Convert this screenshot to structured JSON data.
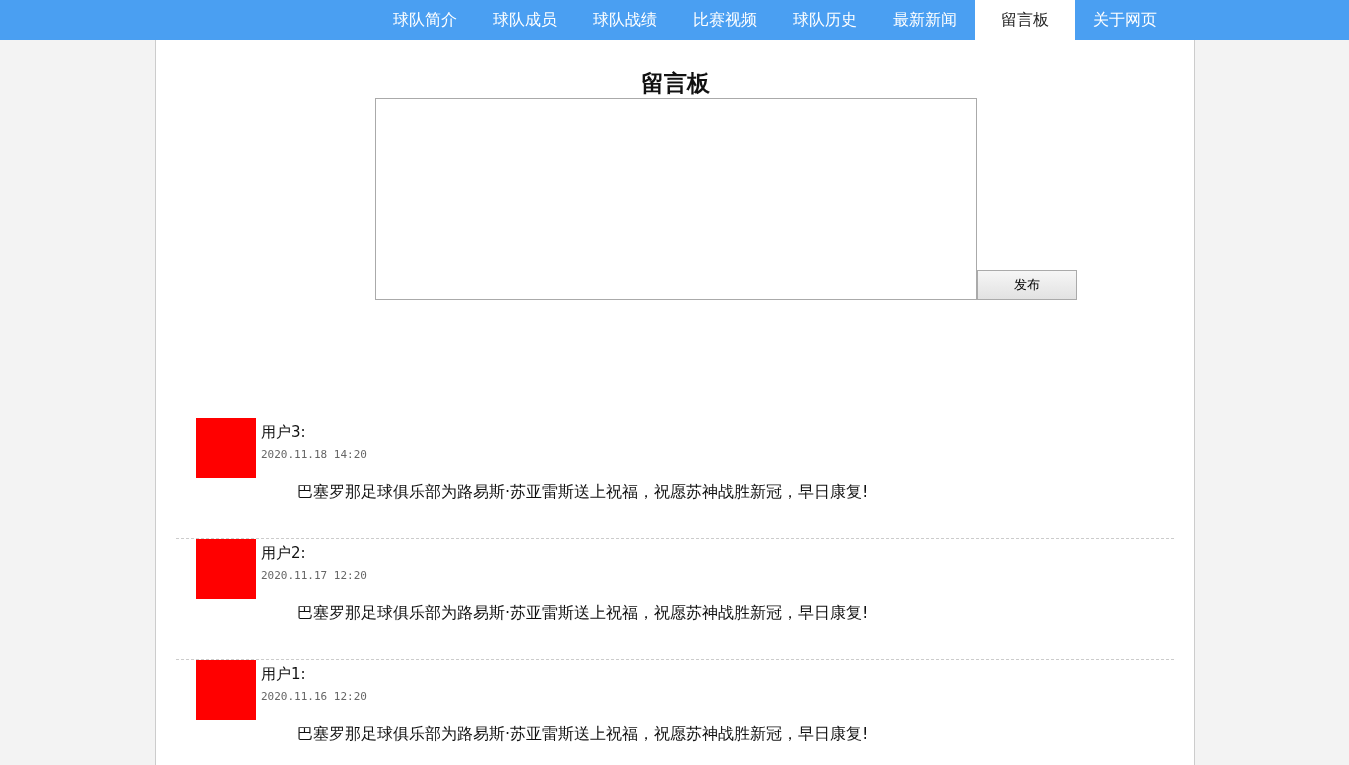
{
  "nav": [
    {
      "label": "球队简介",
      "selected": false
    },
    {
      "label": "球队成员",
      "selected": false
    },
    {
      "label": "球队战绩",
      "selected": false
    },
    {
      "label": "比赛视频",
      "selected": false
    },
    {
      "label": "球队历史",
      "selected": false
    },
    {
      "label": "最新新闻",
      "selected": false
    },
    {
      "label": "留言板",
      "selected": true
    },
    {
      "label": "关于网页",
      "selected": false
    }
  ],
  "board": {
    "title": "留言板",
    "button": "发布"
  },
  "comments": [
    {
      "user": "用户3:",
      "time": "2020.11.18 14:20",
      "message": "巴塞罗那足球俱乐部为路易斯·苏亚雷斯送上祝福，祝愿苏神战胜新冠，早日康复!"
    },
    {
      "user": "用户2:",
      "time": "2020.11.17 12:20",
      "message": "巴塞罗那足球俱乐部为路易斯·苏亚雷斯送上祝福，祝愿苏神战胜新冠，早日康复!"
    },
    {
      "user": "用户1:",
      "time": "2020.11.16 12:20",
      "message": "巴塞罗那足球俱乐部为路易斯·苏亚雷斯送上祝福，祝愿苏神战胜新冠，早日康复!"
    }
  ]
}
